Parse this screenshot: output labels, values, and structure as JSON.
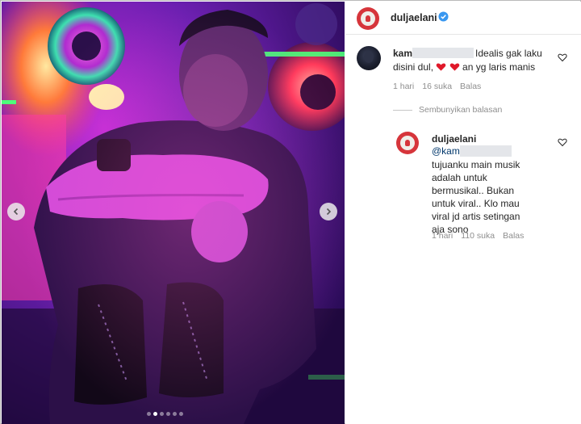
{
  "post": {
    "author": "duljaelani",
    "media": {
      "carousel_dots": 6,
      "active_dot": 1
    }
  },
  "comments": [
    {
      "username": "kam",
      "text_part1": "Idealis gak laku disini dul, ",
      "text_part2": " an yg laris manis",
      "time": "1 hari",
      "likes": "16 suka",
      "reply_label": "Balas"
    }
  ],
  "hide_replies_label": "Sembunyikan balasan",
  "reply": {
    "username": "duljaelani",
    "mention": "@kam",
    "text": "tujuanku main musik adalah untuk bermusikal.. Bukan untuk viral.. Klo mau viral jd artis setingan aja sono",
    "time": "1 hari",
    "likes": "110 suka",
    "reply_label": "Balas"
  },
  "colors": {
    "heart": "#ed4956",
    "verified": "#3897f0",
    "mention": "#00376b",
    "meta_text": "#8e8e8e"
  },
  "icons": {
    "verified": "verified-badge-icon",
    "like": "heart-outline-icon",
    "prev": "chevron-left-icon",
    "next": "chevron-right-icon"
  }
}
